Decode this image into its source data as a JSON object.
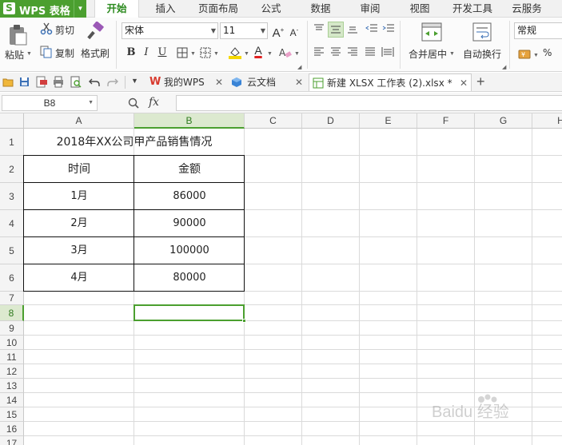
{
  "app": {
    "title": "WPS 表格"
  },
  "menu": {
    "tabs": [
      "开始",
      "插入",
      "页面布局",
      "公式",
      "数据",
      "审阅",
      "视图",
      "开发工具",
      "云服务"
    ],
    "active": "开始"
  },
  "ribbon": {
    "paste": "粘贴",
    "cut": "剪切",
    "copy": "复制",
    "format_painter": "格式刷",
    "font_name": "宋体",
    "font_size": "11",
    "bold": "B",
    "italic": "I",
    "underline": "U",
    "font_grow": "A⁺",
    "font_shrink": "A⁻",
    "merge_center": "合并居中",
    "wrap_text": "自动换行",
    "number_format": "常规",
    "percent": "%"
  },
  "doc_tabs": [
    {
      "label": "我的WPS",
      "icon": "wps-logo-icon"
    },
    {
      "label": "云文档",
      "icon": "cloud-cube-icon"
    },
    {
      "label": "新建 XLSX 工作表 (2).xlsx *",
      "icon": "spreadsheet-doc-icon",
      "active": true
    }
  ],
  "formula_bar": {
    "name_box": "B8",
    "fx": "fx",
    "value": ""
  },
  "grid": {
    "columns": [
      "A",
      "B",
      "C",
      "D",
      "E",
      "F",
      "G",
      "H"
    ],
    "rows": [
      "1",
      "2",
      "3",
      "4",
      "5",
      "6",
      "7",
      "8",
      "9",
      "10",
      "11",
      "12",
      "13",
      "14",
      "15",
      "16",
      "17"
    ],
    "selected_cell": "B8",
    "table": {
      "title": "2018年XX公司甲产品销售情况",
      "headers": [
        "时间",
        "金额"
      ],
      "rows": [
        [
          "1月",
          "86000"
        ],
        [
          "2月",
          "90000"
        ],
        [
          "3月",
          "100000"
        ],
        [
          "4月",
          "80000"
        ]
      ]
    }
  },
  "watermark": "Baidu 经验"
}
